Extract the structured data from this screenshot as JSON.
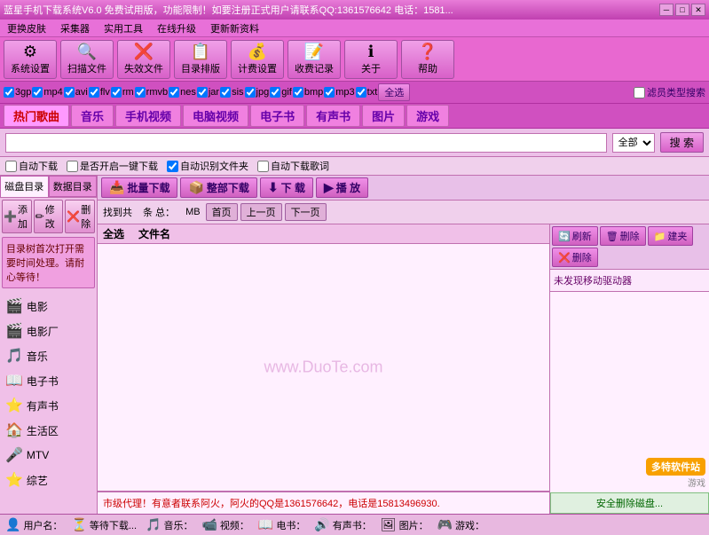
{
  "titleBar": {
    "text": "蓝星手机下载系统V6.0  免费试用版，功能限制！如要注册正式用户请联系QQ:1361576642  电话：1581...",
    "minimizeBtn": "─",
    "maximizeBtn": "□",
    "closeBtn": "✕"
  },
  "menuBar": {
    "items": [
      "更换皮肤",
      "采集器",
      "实用工具",
      "在线升级",
      "更新新资料"
    ]
  },
  "toolbar": {
    "buttons": [
      {
        "icon": "⚙",
        "label": "系统设置"
      },
      {
        "icon": "🔍",
        "label": "扫描文件"
      },
      {
        "icon": "❌",
        "label": "失效文件"
      },
      {
        "icon": "📋",
        "label": "目录排版"
      },
      {
        "icon": "💰",
        "label": "计费设置"
      },
      {
        "icon": "📝",
        "label": "收费记录"
      },
      {
        "icon": "ℹ",
        "label": "关于"
      },
      {
        "icon": "❓",
        "label": "帮助"
      }
    ]
  },
  "catTabs": {
    "tabs": [
      "热门歌曲",
      "音乐",
      "手机视频",
      "电脑视频",
      "电子书",
      "有声书",
      "图片",
      "游戏"
    ],
    "rightLabel": "滤员类型搜索"
  },
  "fileTypes": {
    "items": [
      "3gp",
      "mp4",
      "avi",
      "flv",
      "rm",
      "rmvb",
      "nes",
      "jar",
      "sis",
      "jpg",
      "gif",
      "bmp",
      "mp3",
      "txt"
    ],
    "selectAll": "全选"
  },
  "searchBar": {
    "placeholder": "",
    "btnLabel": "搜 索",
    "dropdownOptions": [
      "全部"
    ]
  },
  "searchOptions": {
    "autoDownload": "自动下载",
    "oneKeyDownload": "是否开启一键下载",
    "autoRecognize": "自动识别文件夹",
    "autoLyrics": "自动下载歌词"
  },
  "dlActions": {
    "buttons": [
      "批量下载",
      "整部下载",
      "下 载",
      "播 放"
    ]
  },
  "sidebarTabs": [
    "磁盘目录",
    "数据目录"
  ],
  "sidebarActions": [
    {
      "icon": "➕",
      "label": "添加"
    },
    {
      "icon": "✏",
      "label": "修改"
    },
    {
      "icon": "❌",
      "label": "删除"
    }
  ],
  "sidebarItems": [
    {
      "icon": "🎬",
      "label": "电影"
    },
    {
      "icon": "🎬",
      "label": "电影厂"
    },
    {
      "icon": "🎵",
      "label": "音乐"
    },
    {
      "icon": "📖",
      "label": "电子书"
    },
    {
      "icon": "⭐",
      "label": "有声书"
    },
    {
      "icon": "🏠",
      "label": "生活区"
    },
    {
      "icon": "🎤",
      "label": "MTV"
    },
    {
      "icon": "⭐",
      "label": "综艺"
    }
  ],
  "noticeBox": {
    "text": "目录树首次打开需要时间处理。请耐心等待！"
  },
  "fileInfo": {
    "findText": "找到共",
    "countVal": "",
    "totalLabel": "条  总：",
    "sizeVal": "",
    "sizeUnit": "MB",
    "pages": [
      "首页",
      "上一页",
      "下一页"
    ]
  },
  "fileTable": {
    "headers": [
      "全选",
      "文件名"
    ],
    "watermark": "www.DuoTe.com"
  },
  "rightTools": {
    "buttons": [
      "刷新",
      "删除",
      "建夹",
      "删除"
    ],
    "deviceInfo": "未发现移动驱动器"
  },
  "promoText": {
    "text": "市级代理！有意者联系阿火，阿火的QQ是1361576642，电话是15813496930."
  },
  "logoBadge": {
    "name": "多特软件站",
    "sub": "游戏"
  },
  "safeRemove": {
    "label": "安全删除磁盘..."
  },
  "statusBar": {
    "items": [
      {
        "icon": "👤",
        "label": "用户名："
      },
      {
        "icon": "⏳",
        "label": "等待下载..."
      },
      {
        "icon": "🎵",
        "label": "音乐："
      },
      {
        "icon": "📹",
        "label": "视频："
      },
      {
        "icon": "📖",
        "label": "电书："
      },
      {
        "icon": "🔊",
        "label": "有声书："
      },
      {
        "icon": "🖼",
        "label": "图片："
      },
      {
        "icon": "🎮",
        "label": "游戏："
      }
    ]
  }
}
